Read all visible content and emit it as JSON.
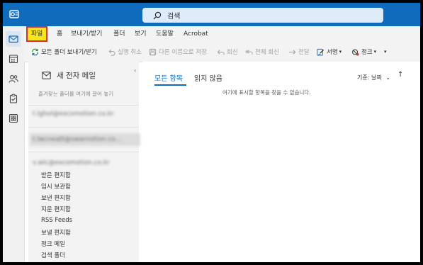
{
  "header": {
    "search_placeholder": "검색"
  },
  "menu": {
    "items": [
      "파일",
      "홈",
      "보내기/받기",
      "폴더",
      "보기",
      "도움말",
      "Acrobat"
    ]
  },
  "ribbon": {
    "send_receive_all": "모든 폴더 보내기/받기",
    "undo": "실행 취소",
    "save_as": "다른 이름으로 저장",
    "reply": "회신",
    "reply_all": "전체 회신",
    "forward": "전달",
    "signature": "서명",
    "junk": "정크"
  },
  "folder_pane": {
    "new_mail": "새 전자 메일",
    "favorites_hint": "즐겨찾는 폴더를 여기에 끌어 놓기",
    "accounts": [
      "t.lghol@excomotion.co.kr",
      "t.lwcneatt@swarnotion.co...",
      "v.wlc@excomotion.co.kr"
    ],
    "folders": [
      "받은 편지함",
      "임시 보관함",
      "보낸 편지함",
      "지운 편지함",
      "RSS Feeds",
      "보낼 편지함",
      "정크 메일",
      "검색 폴더"
    ]
  },
  "message_list": {
    "tabs": [
      "모든 항목",
      "읽지 않음"
    ],
    "sort_label": "기준: 날짜",
    "sort_direction": "↑",
    "empty_message": "여기에 표시할 항목을 찾을 수 없습니다."
  },
  "colors": {
    "titlebar": "#0f6cbd",
    "accent": "#0f6cbd",
    "highlight_fill": "#f8e51c",
    "highlight_border": "#d13438"
  }
}
